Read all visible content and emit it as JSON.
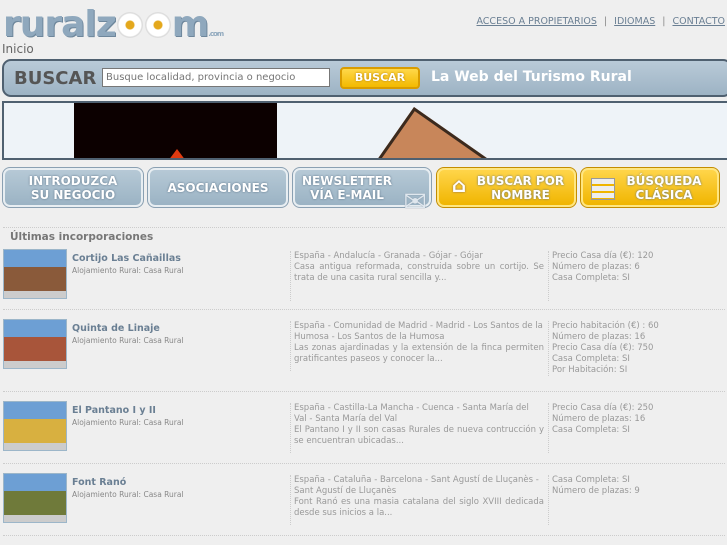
{
  "header": {
    "logo": "ruralzoom",
    "logo_suffix": ".com",
    "links": [
      "ACCESO A PROPIETARIOS",
      "IDIOMAS",
      "CONTACTO"
    ]
  },
  "breadcrumb": "Inicio",
  "search": {
    "label": "BUSCAR",
    "placeholder": "Busque localidad, provincia o negocio",
    "button": "BUSCAR",
    "slogan": "La Web del Turismo Rural"
  },
  "nav": [
    "INTRODUZCA SU NEGOCIO",
    "ASOCIACIONES",
    "NEWSLETTER VÍA E-MAIL",
    "BUSCAR POR NOMBRE",
    "BÚSQUEDA CLÁSICA"
  ],
  "section_title": "Últimas incorporaciones",
  "listings": [
    {
      "title": "Cortijo Las Cañaillas",
      "type": "Alojamiento Rural: Casa Rural",
      "location": "España - Andalucía - Granada - Gójar - Gójar",
      "description": "Casa antigua reformada, construida sobre un cortijo. Se trata de una casita rural sencilla y...",
      "details": [
        "Precio Casa día (€): 120",
        "Número de plazas: 6",
        "Casa Completa: SI"
      ],
      "thumb_color": "#8a5a3a"
    },
    {
      "title": "Quinta de Linaje",
      "type": "Alojamiento Rural: Casa Rural",
      "location": "España - Comunidad de Madrid - Madrid - Los Santos de la Humosa - Los Santos de la Humosa",
      "description": "Las zonas ajardinadas y la extensión de la finca permiten gratificantes paseos y conocer la...",
      "details": [
        "Precio habitación (€) : 60",
        "Número de plazas: 16",
        "Precio Casa día (€): 750",
        "Casa Completa: SI",
        "Por Habitación: SI"
      ],
      "thumb_color": "#a8553a"
    },
    {
      "title": "El Pantano I y II",
      "type": "Alojamiento Rural: Casa Rural",
      "location": "España - Castilla-La Mancha - Cuenca - Santa María del Val - Santa María del Val",
      "description": "El Pantano I y II son casas Rurales de nueva contrucción y se encuentran ubicadas...",
      "details": [
        "Precio Casa día (€): 250",
        "Número de plazas: 16",
        "Casa Completa: SI"
      ],
      "thumb_color": "#d8b040"
    },
    {
      "title": "Font Ranó",
      "type": "Alojamiento Rural: Casa Rural",
      "location": "España - Cataluña - Barcelona - Sant Agustí de Lluçanès - Sant Agustí de Lluçanès",
      "description": "Font Ranó es una masia catalana del siglo XVIII dedicada desde sus inicios a la...",
      "details": [
        "Casa Completa: SI",
        "Número de plazas: 9"
      ],
      "thumb_color": "#6f7a3a"
    }
  ]
}
